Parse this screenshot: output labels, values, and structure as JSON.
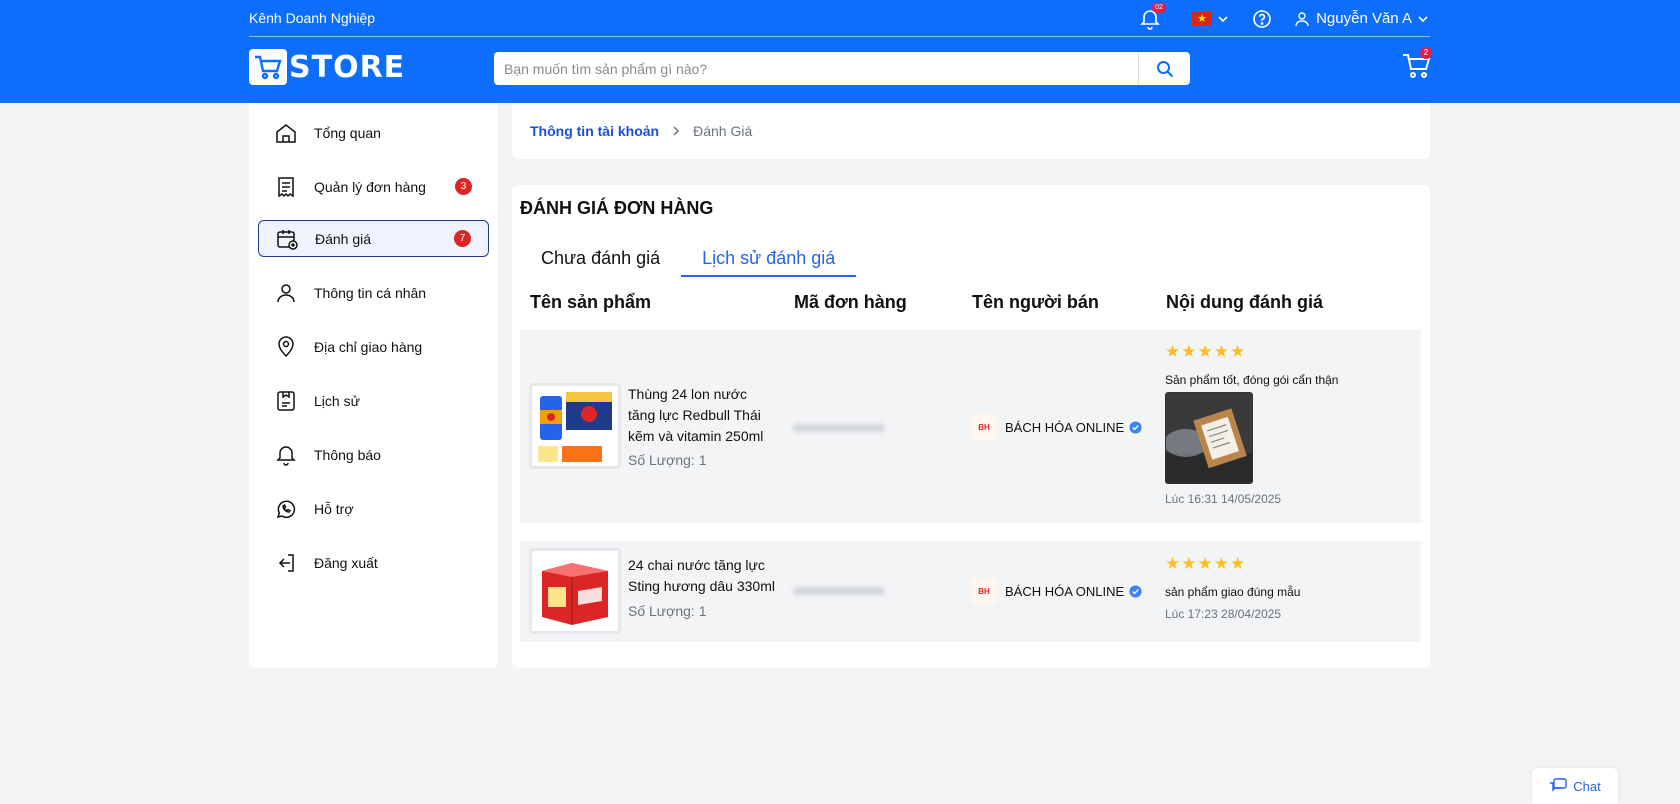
{
  "header": {
    "business_link": "Kênh Doanh Nghiệp",
    "notification_count": "02",
    "user_name": "Nguyễn Văn A",
    "logo_text": "STORE",
    "search_placeholder": "Bạn muốn tìm sản phẩm gì nào?",
    "cart_count": "2",
    "brand_color": "#0d6efd"
  },
  "sidebar": {
    "items": [
      {
        "label": "Tổng quan",
        "icon": "home-icon"
      },
      {
        "label": "Quản lý đơn hàng",
        "icon": "receipt-icon",
        "badge": "3"
      },
      {
        "label": "Đánh giá",
        "icon": "calendar-review-icon",
        "badge": "7",
        "active": true
      },
      {
        "label": "Thông tin cá nhân",
        "icon": "user-icon"
      },
      {
        "label": "Địa chỉ giao hàng",
        "icon": "location-pin-icon"
      },
      {
        "label": "Lịch sử",
        "icon": "history-icon"
      },
      {
        "label": "Thông báo",
        "icon": "bell-icon"
      },
      {
        "label": "Hỗ trợ",
        "icon": "whatsapp-support-icon"
      },
      {
        "label": "Đăng xuất",
        "icon": "logout-icon"
      }
    ]
  },
  "breadcrumb": {
    "parent": "Thông tin tài khoản",
    "current": "Đánh Giá"
  },
  "main": {
    "title": "ĐÁNH GIÁ ĐƠN HÀNG",
    "tabs": [
      {
        "label": "Chưa đánh giá",
        "active": false
      },
      {
        "label": "Lịch sử đánh giá",
        "active": true
      }
    ],
    "columns": [
      "Tên sản phẩm",
      "Mã đơn hàng",
      "Tên người bán",
      "Nội dung đánh giá"
    ],
    "rows": [
      {
        "product_name": "Thùng 24 lon nước tăng lực Redbull Thái kẽm và vitamin 250ml",
        "quantity": "Số Lượng: 1",
        "seller": "BÁCH HÓA ONLINE",
        "stars": "★★★★★",
        "rating": 5,
        "review": "Sản phẩm tốt, đóng gói cẩn thận",
        "time": "Lúc 16:31 14/05/2025"
      },
      {
        "product_name": "24 chai nước tăng lực Sting hương dâu 330ml",
        "quantity": "Số Lượng: 1",
        "seller": "BÁCH HÓA ONLINE",
        "stars": "★★★★★",
        "rating": 5,
        "review": "sản phẩm giao đúng mẫu",
        "time": "Lúc 17:23 28/04/2025"
      }
    ]
  },
  "chat": {
    "label": "Chat"
  }
}
